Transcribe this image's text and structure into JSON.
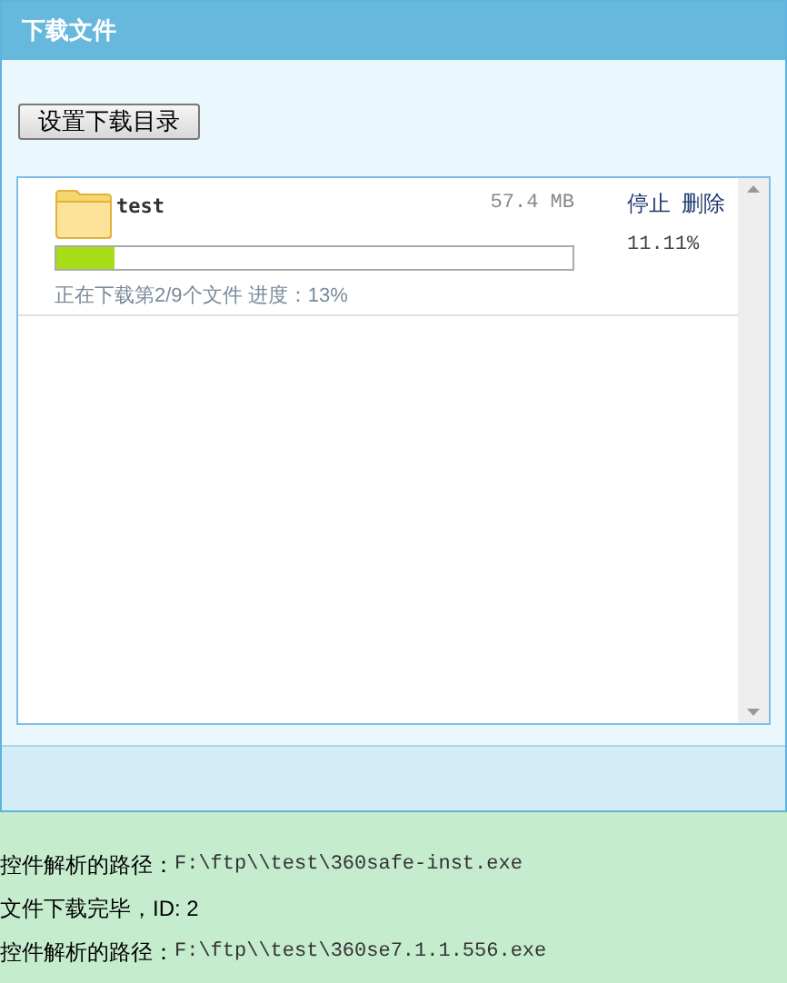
{
  "panel": {
    "title": "下载文件",
    "set_dir_button": "设置下载目录"
  },
  "downloads": [
    {
      "name": "test",
      "size": "57.4 MB",
      "level": 0.1111,
      "percent": "11.11%",
      "status": "正在下载第2/9个文件 进度：13%",
      "actions": [
        "停止",
        "删除"
      ]
    }
  ],
  "log": [
    {
      "label": "控件解析的路径：",
      "value": "F:\\ftp\\\\test\\360safe-inst.exe"
    },
    {
      "label": "文件下载完毕，ID: 2"
    },
    {
      "label": "控件解析的路径：",
      "value": "F:\\ftp\\\\test\\360se7.1.1.556.exe"
    }
  ]
}
